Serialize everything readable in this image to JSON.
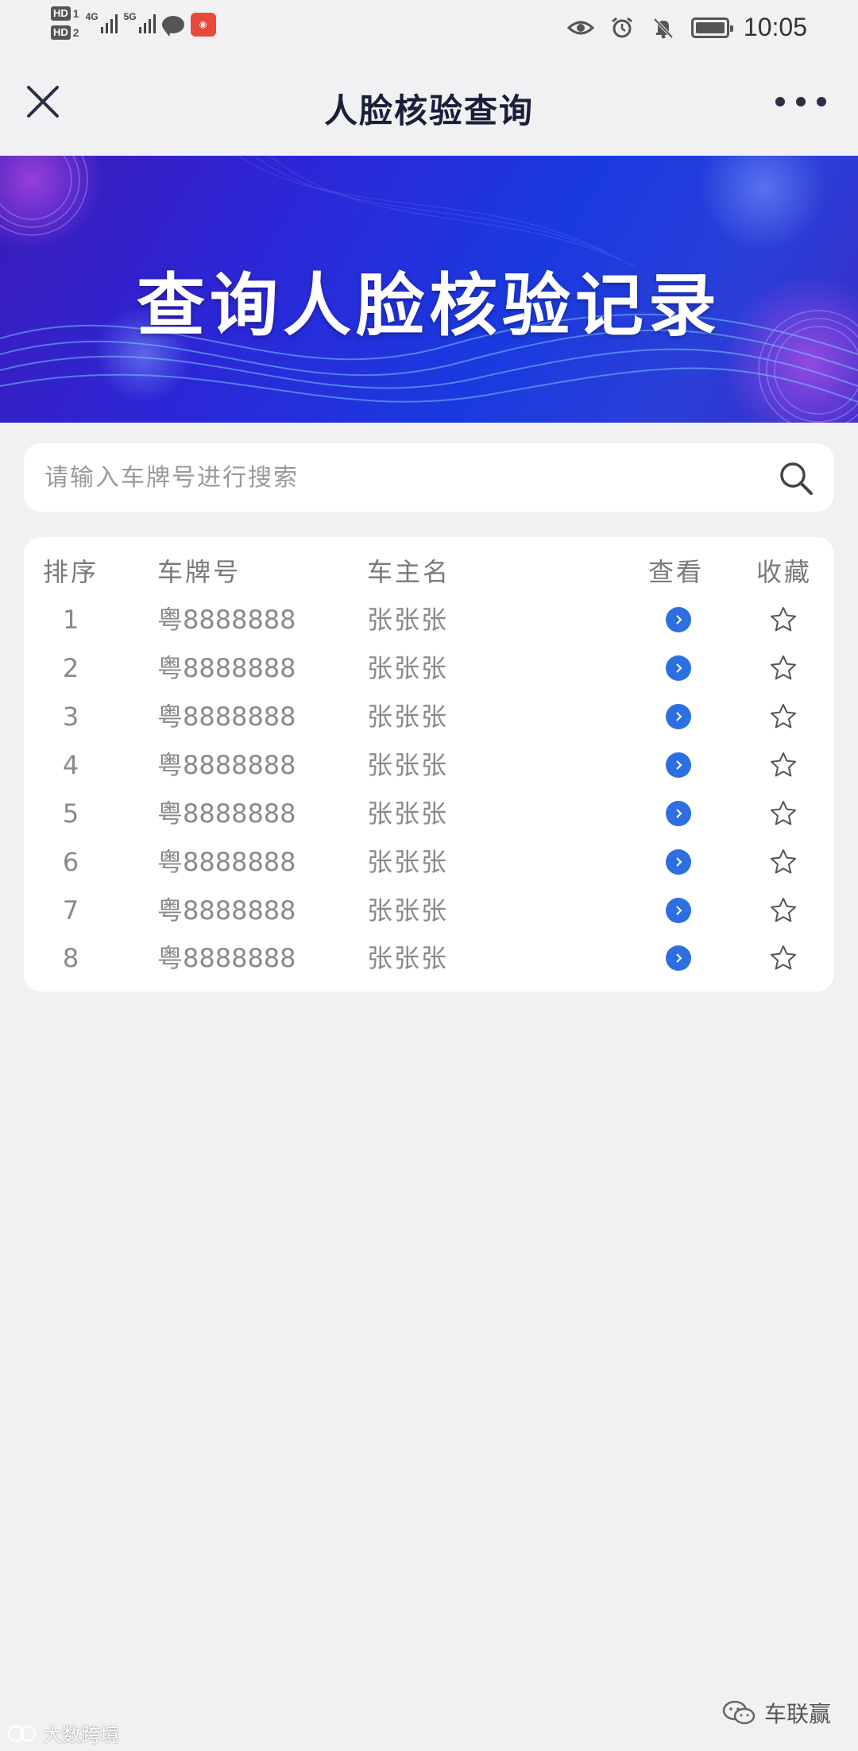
{
  "status_bar": {
    "hd1": "HD",
    "hd1_num": "1",
    "hd2": "HD",
    "hd2_num": "2",
    "net1": "4G",
    "net2": "5G",
    "time": "10:05"
  },
  "header": {
    "title": "人脸核验查询",
    "close_icon": "close-icon",
    "more_icon": "more-icon"
  },
  "banner": {
    "text": "查询人脸核验记录"
  },
  "search": {
    "placeholder": "请输入车牌号进行搜索",
    "value": ""
  },
  "table": {
    "headers": [
      "排序",
      "车牌号",
      "车主名",
      "查看",
      "收藏"
    ],
    "rows": [
      {
        "rank": "1",
        "plate": "粤8888888",
        "owner": "张张张"
      },
      {
        "rank": "2",
        "plate": "粤8888888",
        "owner": "张张张"
      },
      {
        "rank": "3",
        "plate": "粤8888888",
        "owner": "张张张"
      },
      {
        "rank": "4",
        "plate": "粤8888888",
        "owner": "张张张"
      },
      {
        "rank": "5",
        "plate": "粤8888888",
        "owner": "张张张"
      },
      {
        "rank": "6",
        "plate": "粤8888888",
        "owner": "张张张"
      },
      {
        "rank": "7",
        "plate": "粤8888888",
        "owner": "张张张"
      },
      {
        "rank": "8",
        "plate": "粤8888888",
        "owner": "张张张"
      }
    ]
  },
  "watermarks": {
    "left": "大数跨境",
    "right": "车联赢"
  },
  "colors": {
    "accent": "#2d6fe0",
    "title": "#1a1f3a",
    "background": "#f1f1f3",
    "banner_start": "#3b1bb8",
    "banner_end": "#1a3ae0"
  }
}
